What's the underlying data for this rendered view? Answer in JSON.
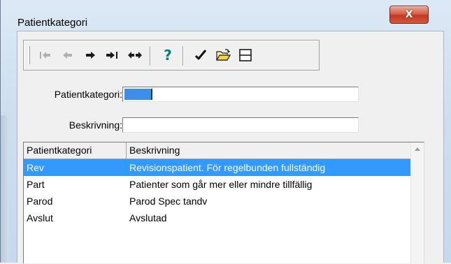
{
  "window": {
    "title": "Patientkategori",
    "close_glyph": "X"
  },
  "toolbar": {
    "buttons": [
      {
        "icon": "first-record-icon",
        "enabled": false
      },
      {
        "icon": "previous-record-icon",
        "enabled": false
      },
      {
        "icon": "next-record-icon",
        "enabled": true
      },
      {
        "icon": "last-record-icon",
        "enabled": true
      },
      {
        "icon": "swap-records-icon",
        "enabled": true
      },
      {
        "icon": "help-icon",
        "enabled": true,
        "glyph": "?"
      },
      {
        "icon": "checkmark-icon",
        "enabled": true
      },
      {
        "icon": "open-folder-icon",
        "enabled": true
      },
      {
        "icon": "split-view-icon",
        "enabled": true
      }
    ]
  },
  "form": {
    "kategori_label": "Patientkategori:",
    "kategori_value": "",
    "beskrivning_label": "Beskrivning:",
    "beskrivning_value": ""
  },
  "grid": {
    "columns": [
      "Patientkategori",
      "Beskrivning"
    ],
    "rows": [
      {
        "kategori": "Rev",
        "beskrivning": "Revisionspatient. För regelbunden fullständig",
        "selected": true
      },
      {
        "kategori": "Part",
        "beskrivning": "Patienter som går mer eller mindre tillfällig",
        "selected": false
      },
      {
        "kategori": "Parod",
        "beskrivning": "Parod Spec tandv",
        "selected": false
      },
      {
        "kategori": "Avslut",
        "beskrivning": "Avslutad",
        "selected": false
      }
    ]
  },
  "colors": {
    "selection": "#3399ff",
    "nav_arrow_enabled": "#1a1a1a",
    "nav_arrow_disabled": "#b0b0b0",
    "help": "#008080",
    "close_button": "#c6452c"
  }
}
